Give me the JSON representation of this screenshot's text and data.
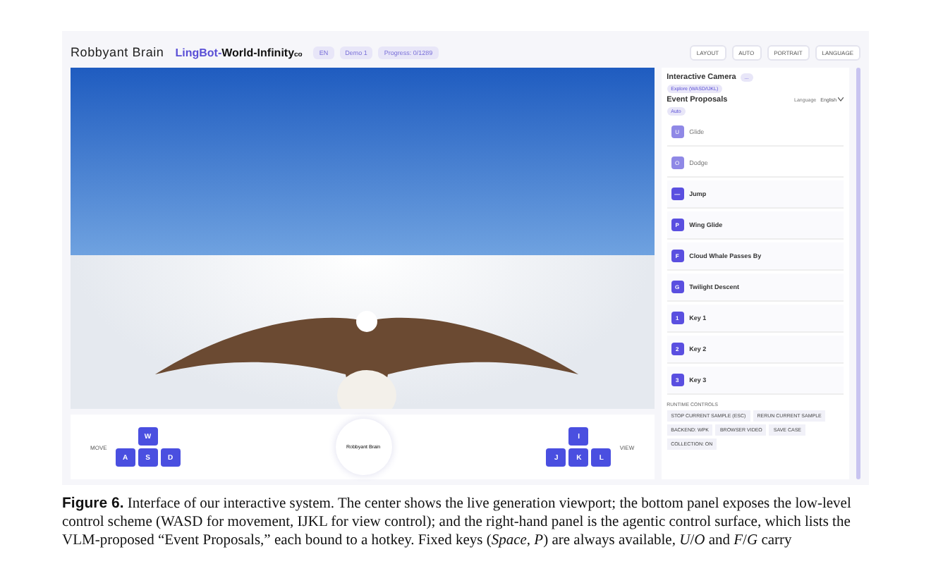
{
  "header": {
    "brand": "Robbyant Brain",
    "product_prefix": "LingBot-",
    "product": "World-Infinity",
    "product_suffix": "co",
    "badges": [
      "EN",
      "Demo 1",
      "Progress: 0/1289"
    ],
    "actions": [
      "LAYOUT",
      "AUTO",
      "PORTRAIT",
      "LANGUAGE"
    ]
  },
  "panel": {
    "camera_title": "Interactive Camera",
    "camera_badge": "...",
    "camera_mode": "Explore (WASD/IJKL)",
    "events_title": "Event Proposals",
    "language_label": "Language",
    "language_value": "English",
    "auto_badge": "Auto",
    "events": [
      {
        "key": "U",
        "title": "Glide",
        "disabled": true
      },
      {
        "key": "O",
        "title": "Dodge",
        "disabled": true
      },
      {
        "key": "—",
        "title": "Jump",
        "disabled": false
      },
      {
        "key": "P",
        "title": "Wing Glide",
        "disabled": false
      },
      {
        "key": "F",
        "title": "Cloud Whale Passes By",
        "disabled": false
      },
      {
        "key": "G",
        "title": "Twilight Descent",
        "disabled": false
      },
      {
        "key": "1",
        "title": "Key 1",
        "disabled": false
      },
      {
        "key": "2",
        "title": "Key 2",
        "disabled": false
      },
      {
        "key": "3",
        "title": "Key 3",
        "disabled": false
      }
    ],
    "runtime_title": "RUNTIME CONTROLS",
    "runtime_buttons": [
      "STOP CURRENT SAMPLE (ESC)",
      "RERUN CURRENT SAMPLE",
      "BACKEND: WPK",
      "BROWSER VIDEO",
      "SAVE CASE",
      "COLLECTION: ON"
    ]
  },
  "controls": {
    "move_label": "MOVE",
    "move_keys": [
      "W",
      "A",
      "S",
      "D"
    ],
    "center": "Robbyant Brain",
    "view_keys": [
      "I",
      "J",
      "K",
      "L"
    ],
    "view_label": "VIEW"
  },
  "caption": "**Figure 6.** Interface of our interactive system. The center shows the live generation viewport; the bottom panel exposes the low-level control scheme (WASD for movement, IJKL for view control); and the right-hand panel is the agentic control surface, which lists the VLM-proposed “Event Proposals,” each bound to a hotkey. Fixed keys (*Space*, *P*) are always available, *U*/*O* and *F*/*G* carry"
}
